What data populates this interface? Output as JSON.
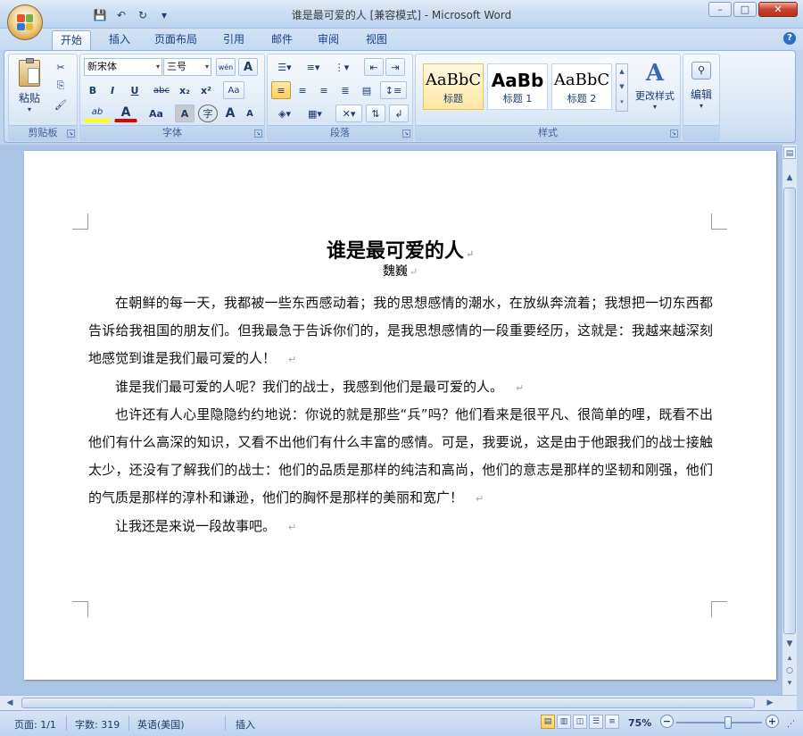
{
  "window": {
    "title": "谁是最可爱的人 [兼容模式] - Microsoft Word",
    "minimize": "–",
    "maximize": "□",
    "close": "✕"
  },
  "quick_access": {
    "save_icon": "💾",
    "undo_icon": "↶",
    "redo_icon": "↻",
    "customize_icon": "▾"
  },
  "tabs": [
    {
      "label": "开始"
    },
    {
      "label": "插入"
    },
    {
      "label": "页面布局"
    },
    {
      "label": "引用"
    },
    {
      "label": "邮件"
    },
    {
      "label": "审阅"
    },
    {
      "label": "视图"
    }
  ],
  "help_label": "?",
  "ribbon": {
    "clipboard": {
      "label": "剪贴板",
      "paste": "粘贴",
      "cut_icon": "✂",
      "copy_icon": "⎘",
      "format_painter_icon": "🖌"
    },
    "font": {
      "label": "字体",
      "font_name": "新宋体",
      "font_size": "三号",
      "pinyin": "wén",
      "border_A": "A",
      "bold": "B",
      "italic": "I",
      "underline": "U",
      "strike": "abc",
      "subscript": "x₂",
      "superscript": "x²",
      "clear_format": "Aa",
      "highlight": "ab",
      "font_color": "A",
      "change_case": "Aa",
      "shade": "A",
      "enclose": "字",
      "grow": "A",
      "shrink": "A"
    },
    "paragraph": {
      "label": "段落"
    },
    "styles": {
      "label": "样式",
      "items": [
        {
          "sample": "AaBbC",
          "name": "标题"
        },
        {
          "sample": "AaBb",
          "name": "标题 1"
        },
        {
          "sample": "AaBbC",
          "name": "标题 2"
        }
      ],
      "change_styles": "更改样式"
    },
    "editing": {
      "label": "编辑"
    }
  },
  "document": {
    "title": "谁是最可爱的人",
    "author": "魏巍",
    "paragraphs": [
      "在朝鲜的每一天，我都被一些东西感动着；我的思想感情的潮水，在放纵奔流着；我想把一切东西都告诉给我祖国的朋友们。但我最急于告诉你们的，是我思想感情的一段重要经历，这就是：我越来越深刻地感觉到谁是我们最可爱的人！",
      "谁是我们最可爱的人呢？我们的战士，我感到他们是最可爱的人。",
      "也许还有人心里隐隐约约地说：你说的就是那些“兵”吗？他们看来是很平凡、很简单的哩，既看不出他们有什么高深的知识，又看不出他们有什么丰富的感情。可是，我要说，这是由于他跟我们的战士接触太少，还没有了解我们的战士：他们的品质是那样的纯洁和高尚，他们的意志是那样的坚韧和刚强，他们的气质是那样的淳朴和谦逊，他们的胸怀是那样的美丽和宽广！",
      "让我还是来说一段故事吧。"
    ],
    "paragraph_mark": "↵"
  },
  "statusbar": {
    "page": "页面: 1/1",
    "words": "字数: 319",
    "language": "英语(美国)",
    "insert": "插入",
    "zoom": "75%",
    "zoom_level": 0.6,
    "zoom_out": "−",
    "zoom_in": "+"
  },
  "colors": {
    "highlight": "#ffff00",
    "font_color": "#e00000",
    "accent": "#15428b"
  }
}
